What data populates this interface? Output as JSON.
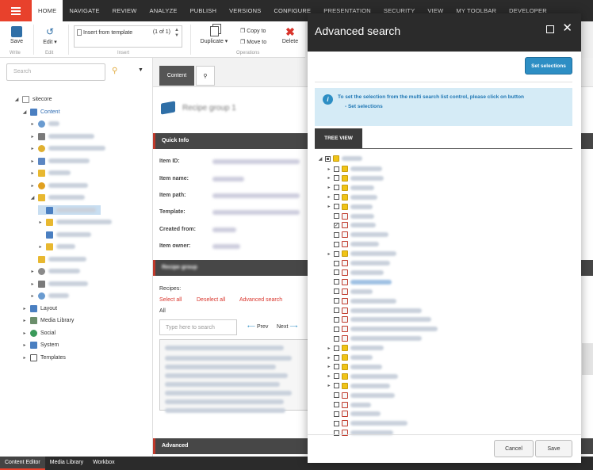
{
  "menu": {
    "tabs": [
      "HOME",
      "NAVIGATE",
      "REVIEW",
      "ANALYZE",
      "PUBLISH",
      "VERSIONS",
      "CONFIGURE",
      "PRESENTATION",
      "SECURITY",
      "VIEW",
      "MY TOOLBAR",
      "DEVELOPER"
    ]
  },
  "ribbon": {
    "save": "Save",
    "write_group": "Write",
    "edit": "Edit",
    "edit_group": "Edit",
    "insert_template": "Insert from template",
    "insert_count": "(1 of 1)",
    "insert_group": "Insert",
    "duplicate": "Duplicate",
    "copy_to": "Copy to",
    "move_to": "Move to",
    "delete": "Delete",
    "operations_group": "Operations"
  },
  "left": {
    "search_placeholder": "Search",
    "tree": {
      "root": "sitecore",
      "content": "Content",
      "layout": "Layout",
      "media": "Media Library",
      "social": "Social",
      "system": "System",
      "templates": "Templates"
    }
  },
  "content": {
    "tab_content": "Content",
    "item_title": "Recipe group 1",
    "quick_info": "Quick Info",
    "fields": {
      "id": "Item ID:",
      "name": "Item name:",
      "path": "Item path:",
      "template": "Template:",
      "created": "Created from:",
      "owner": "Item owner:"
    },
    "section2": "Recipe group",
    "recipes_label": "Recipes:",
    "select_all": "Select all",
    "deselect_all": "Deselect all",
    "advanced_search": "Advanced search",
    "all": "All",
    "filter_placeholder": "Type here to search",
    "prev": "Prev",
    "next": "Next",
    "advanced": "Advanced"
  },
  "dialog": {
    "title": "Advanced search",
    "set_selections": "Set selections",
    "info_line1": "To set the selection from the multi search list control, please click on button",
    "info_line2": "- Set selections",
    "tree_view": "TREE VIEW",
    "cancel": "Cancel",
    "save": "Save"
  },
  "bottom": {
    "tabs": [
      "Content Editor",
      "Media Library",
      "Workbox"
    ]
  },
  "colors": {
    "accent": "#e8412c",
    "topbar": "#2b2b2b",
    "button_blue": "#2d8ec4",
    "info_bg": "#d5ebf6",
    "link_red": "#d9342b"
  }
}
